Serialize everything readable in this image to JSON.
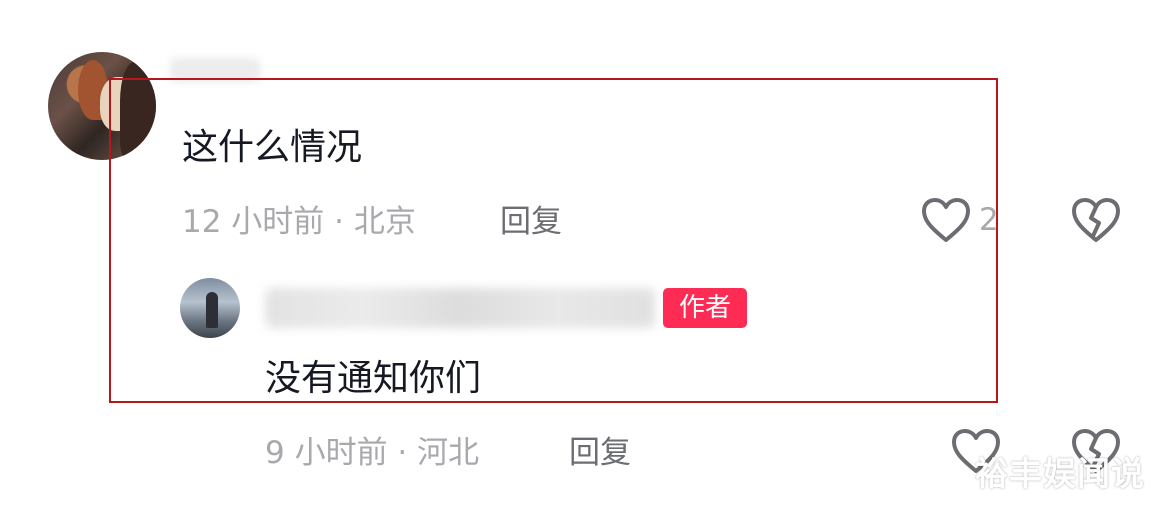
{
  "comment": {
    "text": "这什么情况",
    "meta": "12 小时前 · 北京",
    "reply_label": "回复",
    "like_count": "2"
  },
  "reply": {
    "author_badge": "作者",
    "text": "没有通知你们",
    "meta": "9 小时前 · 河北",
    "reply_label": "回复"
  },
  "watermark": "裕丰娱闻说",
  "colors": {
    "text_primary": "#161823",
    "text_secondary": "#a8a9ad",
    "badge": "#fe2c55",
    "highlight_border": "#b4171c"
  },
  "icons": [
    "heart-icon",
    "dislike-heart-icon"
  ]
}
